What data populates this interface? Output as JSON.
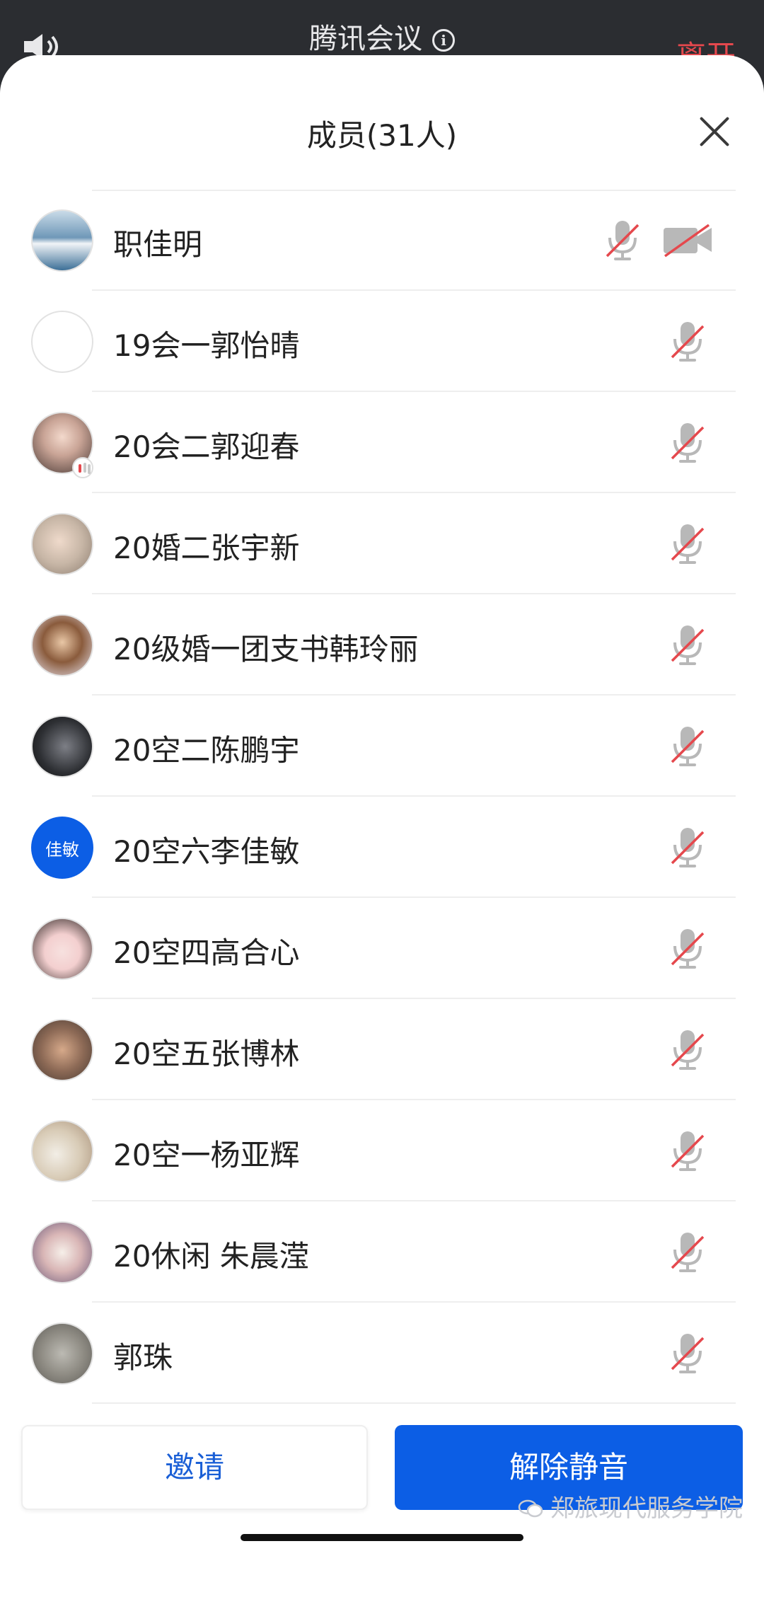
{
  "status_bar": {
    "app_title": "腾讯会议",
    "leave_label": "离开"
  },
  "sheet": {
    "title": "成员(31人)"
  },
  "members": [
    {
      "name": "职佳明",
      "mic": "muted",
      "camera": "off",
      "avatar_text": ""
    },
    {
      "name": "19会一郭怡晴",
      "mic": "muted",
      "avatar_text": ""
    },
    {
      "name": "20会二郭迎春",
      "mic": "muted",
      "avatar_text": ""
    },
    {
      "name": "20婚二张宇新",
      "mic": "muted",
      "avatar_text": ""
    },
    {
      "name": "20级婚一团支书韩玲丽",
      "mic": "muted",
      "avatar_text": ""
    },
    {
      "name": "20空二陈鹏宇",
      "mic": "muted",
      "avatar_text": ""
    },
    {
      "name": "20空六李佳敏",
      "mic": "muted",
      "avatar_text": "佳敏"
    },
    {
      "name": "20空四高合心",
      "mic": "muted",
      "avatar_text": ""
    },
    {
      "name": "20空五张博林",
      "mic": "muted",
      "avatar_text": ""
    },
    {
      "name": "20空一杨亚辉",
      "mic": "muted",
      "avatar_text": ""
    },
    {
      "name": "20休闲 朱晨滢",
      "mic": "muted",
      "avatar_text": ""
    },
    {
      "name": "郭珠",
      "mic": "muted",
      "avatar_text": ""
    }
  ],
  "actions": {
    "invite_label": "邀请",
    "unmute_label": "解除静音"
  },
  "watermark": {
    "text": "郑旅现代服务学院"
  },
  "colors": {
    "primary_blue": "#0c5ee5",
    "invite_text": "#1a5fd6",
    "mute_red": "#e5484d",
    "icon_gray": "#b8b8b8"
  }
}
